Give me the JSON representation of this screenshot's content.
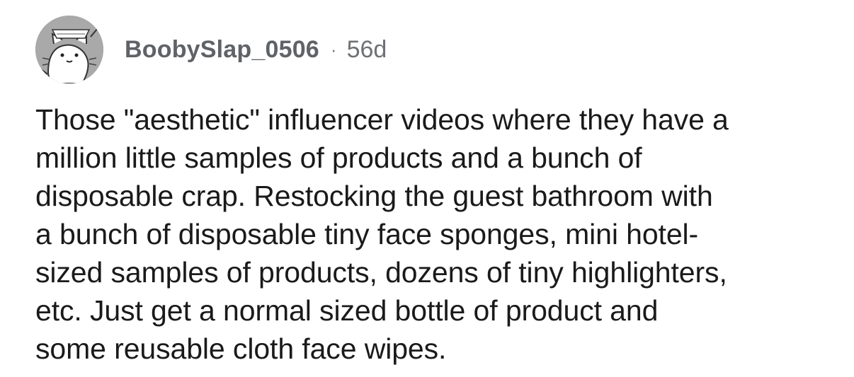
{
  "comment": {
    "author": {
      "username": "BoobySlap_0506",
      "avatar_icon": "cartoon-cat-avatar-icon"
    },
    "separator": "·",
    "age": "56d",
    "text": "Those \"aesthetic\" influencer videos where they have a\nmillion little samples of products and a bunch of\ndisposable crap. Restocking the guest bathroom with\na bunch of disposable tiny face sponges, mini hotel-\nsized samples of products, dozens of tiny highlighters,\netc. Just get a normal sized bottle of product and\nsome reusable cloth face wipes."
  },
  "colors": {
    "background": "#ffffff",
    "username": "#5f6266",
    "meta": "#6e7175",
    "text": "#1a1a1b",
    "avatar_bg": "#a9a9a9"
  }
}
